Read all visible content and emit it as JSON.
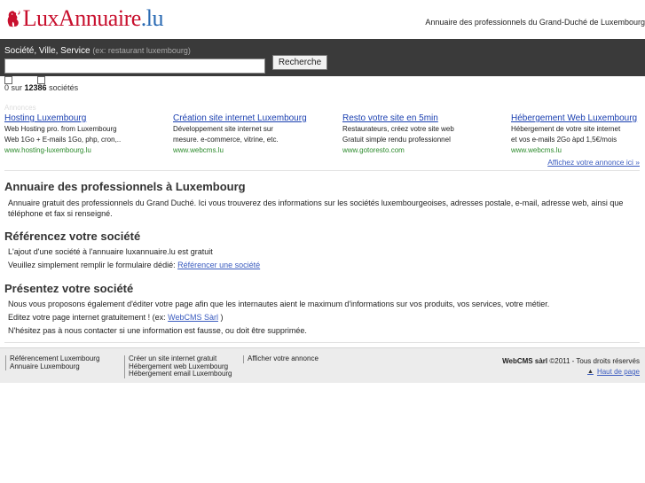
{
  "header": {
    "logo_main": "LuxAnnuaire",
    "logo_tld": ".lu",
    "tagline": "Annuaire des professionnels du Grand-Duché de Luxembourg"
  },
  "search": {
    "label": "Société, Ville, Service",
    "hint": "(ex: restaurant luxembourg)",
    "value": "",
    "placeholder": "",
    "button": "Recherche"
  },
  "results": {
    "prefix": "0 sur",
    "total": "12386",
    "suffix": "sociétés"
  },
  "ads": {
    "label": "Annonces",
    "items": [
      {
        "title": "Hosting Luxembourg",
        "line1": "Web Hosting pro. from Luxembourg",
        "line2": "Web 1Go + E-mails 1Go, php, cron,..",
        "url": "www.hosting-luxembourg.lu"
      },
      {
        "title": "Création site internet Luxembourg",
        "line1": "Développement site internet sur",
        "line2": "mesure. e-commerce, vitrine, etc.",
        "url": "www.webcms.lu"
      },
      {
        "title": "Resto votre site en 5min",
        "line1": "Restaurateurs, créez votre site web",
        "line2": "Gratuit simple rendu professionnel",
        "url": "www.gotoresto.com"
      },
      {
        "title": "Hébergement Web Luxembourg",
        "line1": "Hébergement de votre site internet",
        "line2": "et vos e-mails 2Go àpd 1,5€/mois",
        "url": "www.webcms.lu"
      }
    ],
    "more": "Affichez votre annonce ici »"
  },
  "sections": {
    "s1": {
      "title": "Annuaire des professionnels à Luxembourg",
      "text": "Annuaire gratuit des professionnels du Grand Duché. Ici vous trouverez des informations sur les sociétés luxembourgeoises, adresses postale, e-mail, adresse web, ainsi que téléphone et fax si renseigné."
    },
    "s2": {
      "title": "Référencez votre société",
      "line1": "L'ajout d'une société à l'annuaire luxannuaire.lu est gratuit",
      "line2_prefix": "Veuillez simplement remplir le formulaire dédié:",
      "line2_link": "Référencer une société"
    },
    "s3": {
      "title": "Présentez votre société",
      "line1": "Nous vous proposons également d'éditer votre page afin que les internautes aient le maximum d'informations sur vos produits, vos services, votre métier.",
      "line2_prefix": "Editez votre page internet gratuitement ! (ex:",
      "line2_link": "WebCMS Sàrl",
      "line2_suffix": ")",
      "line3": "N'hésitez pas à nous contacter si une information est fausse, ou doit être supprimée."
    }
  },
  "footer": {
    "col1": [
      "Référencement Luxembourg",
      "Annuaire Luxembourg"
    ],
    "col2": [
      "Créer un site internet gratuit",
      "Hébergement web Luxembourg",
      "Hébergement email Luxembourg"
    ],
    "col3": [
      "Afficher votre annonce"
    ],
    "company": "WebCMS sàrl",
    "copyright": "©2011 - Tous droits réservés",
    "top_link": "Haut de page"
  }
}
